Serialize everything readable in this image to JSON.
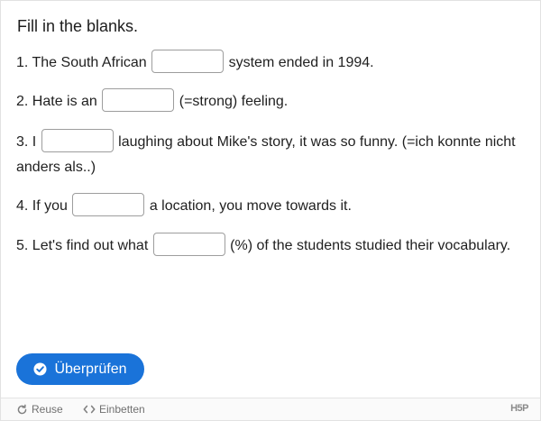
{
  "title": "Fill in the blanks.",
  "questions": [
    {
      "before": "1. The South African",
      "after": "system ended in 1994.",
      "value": ""
    },
    {
      "before": "2. Hate is an",
      "after": "(=strong) feeling.",
      "value": ""
    },
    {
      "before": "3. I",
      "after": "laughing about Mike's story, it was so funny. (=ich konnte nicht anders als..)",
      "value": ""
    },
    {
      "before": "4. If you",
      "after": "a location, you move towards it.",
      "value": ""
    },
    {
      "before": "5. Let's find out what",
      "after": "(%) of the students studied their vocabulary.",
      "value": ""
    }
  ],
  "check_button": {
    "label": "Überprüfen",
    "icon": "check-circle-icon"
  },
  "footer": {
    "reuse_label": "Reuse",
    "embed_label": "Einbetten",
    "brand": "H5P"
  },
  "colors": {
    "accent": "#1a73d9"
  }
}
